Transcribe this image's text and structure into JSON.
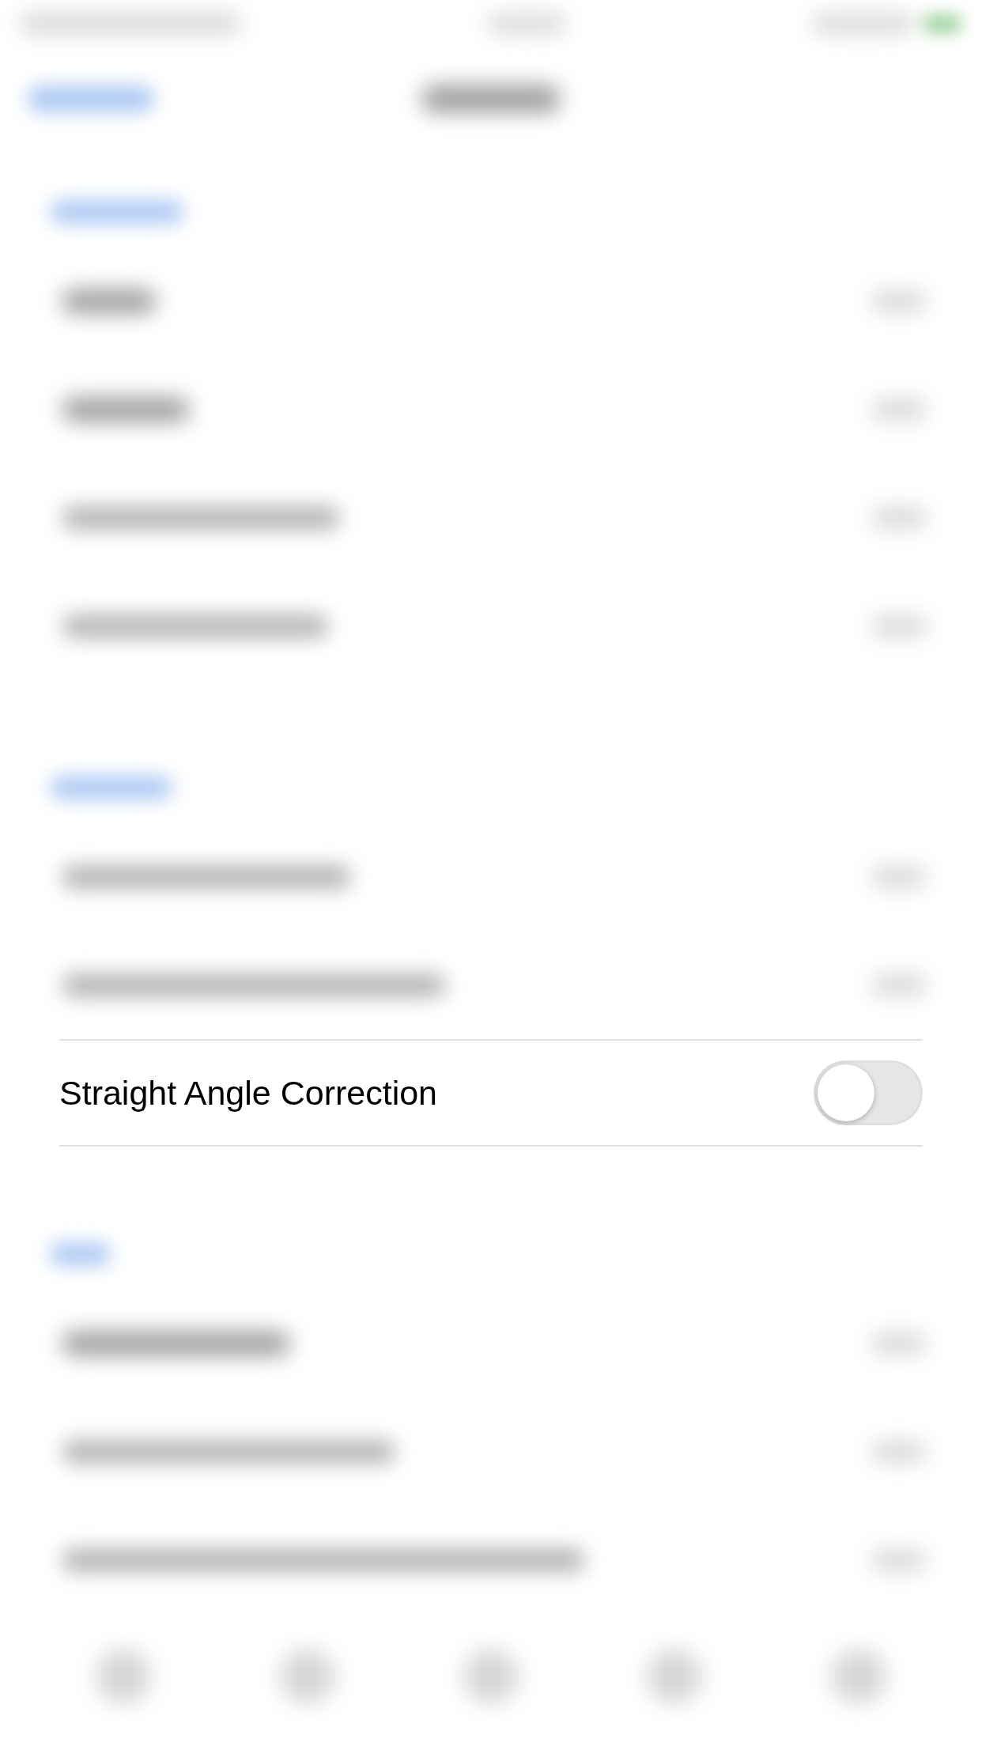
{
  "backdrop": {
    "kind": "blurred"
  },
  "settings_row": {
    "label": "Straight Angle Correction",
    "on": false
  }
}
